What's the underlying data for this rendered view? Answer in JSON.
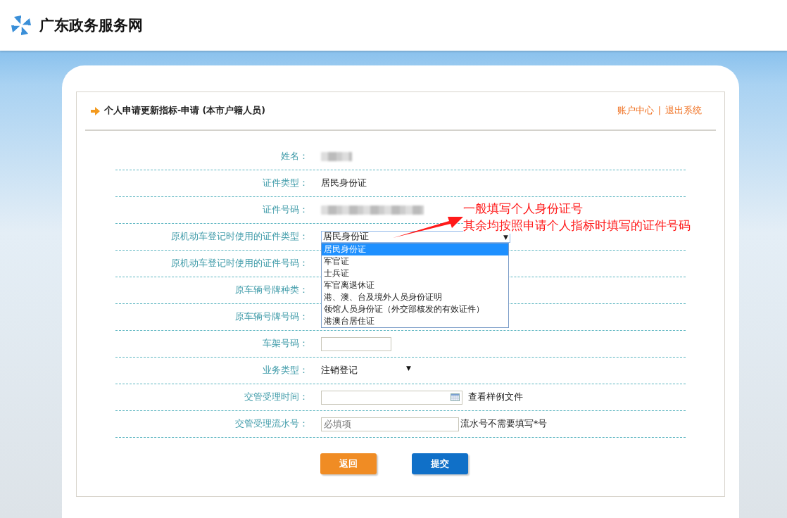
{
  "header": {
    "title": "广东政务服务网"
  },
  "panel": {
    "title": "个人申请更新指标-申请 (本市户籍人员)",
    "links": [
      "账户中心",
      "退出系统"
    ],
    "separator": "|"
  },
  "form": {
    "rows": [
      {
        "kind": "redacted",
        "label": "姓名："
      },
      {
        "kind": "text",
        "label": "证件类型：",
        "value": "居民身份证"
      },
      {
        "kind": "redacted-wide",
        "label": "证件号码："
      },
      {
        "kind": "dropdown",
        "label": "原机动车登记时使用的证件类型：",
        "value": "居民身份证",
        "caret": "▼",
        "expanded": true,
        "options": [
          {
            "label": "居民身份证",
            "selected": true
          },
          {
            "label": "军官证",
            "selected": false
          },
          {
            "label": "士兵证",
            "selected": false
          },
          {
            "label": "军官离退休证",
            "selected": false
          },
          {
            "label": "港、澳、台及境外人员身份证明",
            "selected": false
          },
          {
            "label": "领馆人员身份证（外交部核发的有效证件）",
            "selected": false
          },
          {
            "label": "港澳台居住证",
            "selected": false
          }
        ]
      },
      {
        "kind": "covered",
        "label": "原机动车登记时使用的证件号码："
      },
      {
        "kind": "covered",
        "label": "原车辆号牌种类："
      },
      {
        "kind": "covered",
        "label": "原车辆号牌号码："
      },
      {
        "kind": "input",
        "label": "车架号码："
      },
      {
        "kind": "plain-select",
        "label": "业务类型：",
        "value": "注销登记",
        "caret": "▼"
      },
      {
        "kind": "date",
        "label": "交管受理时间：",
        "note": "查看样例文件"
      },
      {
        "kind": "input-note",
        "label": "交管受理流水号：",
        "placeholder": "必填项",
        "note": "流水号不需要填写*号"
      }
    ]
  },
  "annotation": {
    "lines": [
      "一般填写个人身份证号",
      "其余均按照申请个人指标时填写的证件号码"
    ]
  },
  "buttons": [
    {
      "label": "返回",
      "color": "#f08c24"
    },
    {
      "label": "提交",
      "color": "#1070c8"
    }
  ]
}
